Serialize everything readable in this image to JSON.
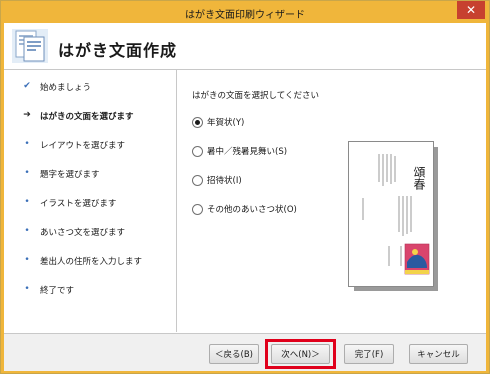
{
  "window": {
    "title": "はがき文面印刷ウィザード",
    "close_label": "✕"
  },
  "header": {
    "title": "はがき文面作成",
    "icon": "postcard-document-icon"
  },
  "sidebar": {
    "steps": [
      {
        "marker": "✔",
        "label": "始めましょう",
        "state": "done"
      },
      {
        "marker": "➔",
        "label": "はがきの文面を選びます",
        "state": "current"
      },
      {
        "marker": "•",
        "label": "レイアウトを選びます",
        "state": "pending"
      },
      {
        "marker": "•",
        "label": "題字を選びます",
        "state": "pending"
      },
      {
        "marker": "•",
        "label": "イラストを選びます",
        "state": "pending"
      },
      {
        "marker": "•",
        "label": "あいさつ文を選びます",
        "state": "pending"
      },
      {
        "marker": "•",
        "label": "差出人の住所を入力します",
        "state": "pending"
      },
      {
        "marker": "•",
        "label": "終了です",
        "state": "pending"
      }
    ]
  },
  "main": {
    "instruction": "はがきの文面を選択してください",
    "options": [
      {
        "label": "年賀状(Y)",
        "selected": true
      },
      {
        "label": "暑中／残暑見舞い(S)",
        "selected": false
      },
      {
        "label": "招待状(I)",
        "selected": false
      },
      {
        "label": "その他のあいさつ状(O)",
        "selected": false
      }
    ],
    "preview": {
      "greeting": "頌春"
    }
  },
  "footer": {
    "back": "＜戻る(B)",
    "next": "次へ(N)＞",
    "finish": "完了(F)",
    "cancel": "キャンセル"
  },
  "colors": {
    "titlebar": "#f0b63b",
    "highlight": "#e0001b",
    "accent": "#3a6fb8"
  }
}
